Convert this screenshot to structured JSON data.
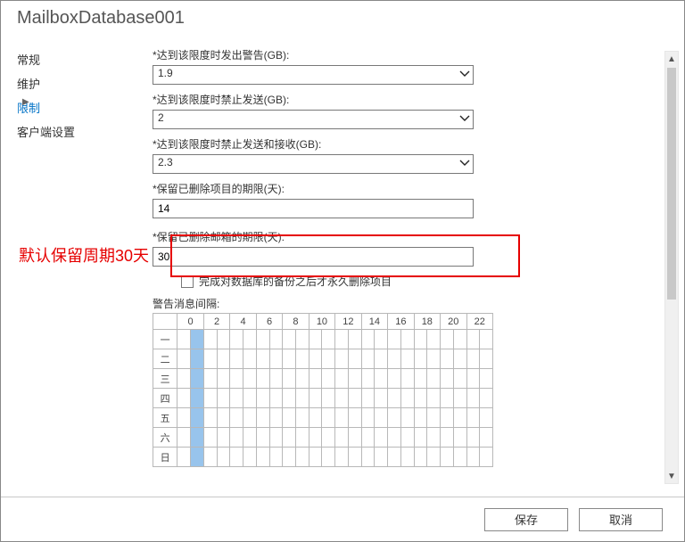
{
  "title": "MailboxDatabase001",
  "sidebar": {
    "items": [
      {
        "label": "常规"
      },
      {
        "label": "维护"
      },
      {
        "label": "限制"
      },
      {
        "label": "客户端设置"
      }
    ],
    "active_index": 2
  },
  "fields": {
    "warn_label": "*达到该限度时发出警告(GB):",
    "warn_value": "1.9",
    "prohibit_send_label": "*达到该限度时禁止发送(GB):",
    "prohibit_send_value": "2",
    "prohibit_sr_label": "*达到该限度时禁止发送和接收(GB):",
    "prohibit_sr_value": "2.3",
    "keep_items_label": "*保留已删除项目的期限(天):",
    "keep_items_value": "14",
    "keep_mbx_label": "*保留已删除邮箱的期限(天):",
    "keep_mbx_value": "30",
    "perm_delete_label": "完成对数据库的备份之后才永久删除项目",
    "perm_delete_checked": false
  },
  "annotation": {
    "text": "默认保留周期30天"
  },
  "schedule": {
    "label": "警告消息间隔:",
    "hours": [
      "0",
      "2",
      "4",
      "6",
      "8",
      "10",
      "12",
      "14",
      "16",
      "18",
      "20",
      "22"
    ],
    "days": [
      "一",
      "二",
      "三",
      "四",
      "五",
      "六",
      "日"
    ],
    "highlight_col": 1
  },
  "footer": {
    "save": "保存",
    "cancel": "取消"
  }
}
